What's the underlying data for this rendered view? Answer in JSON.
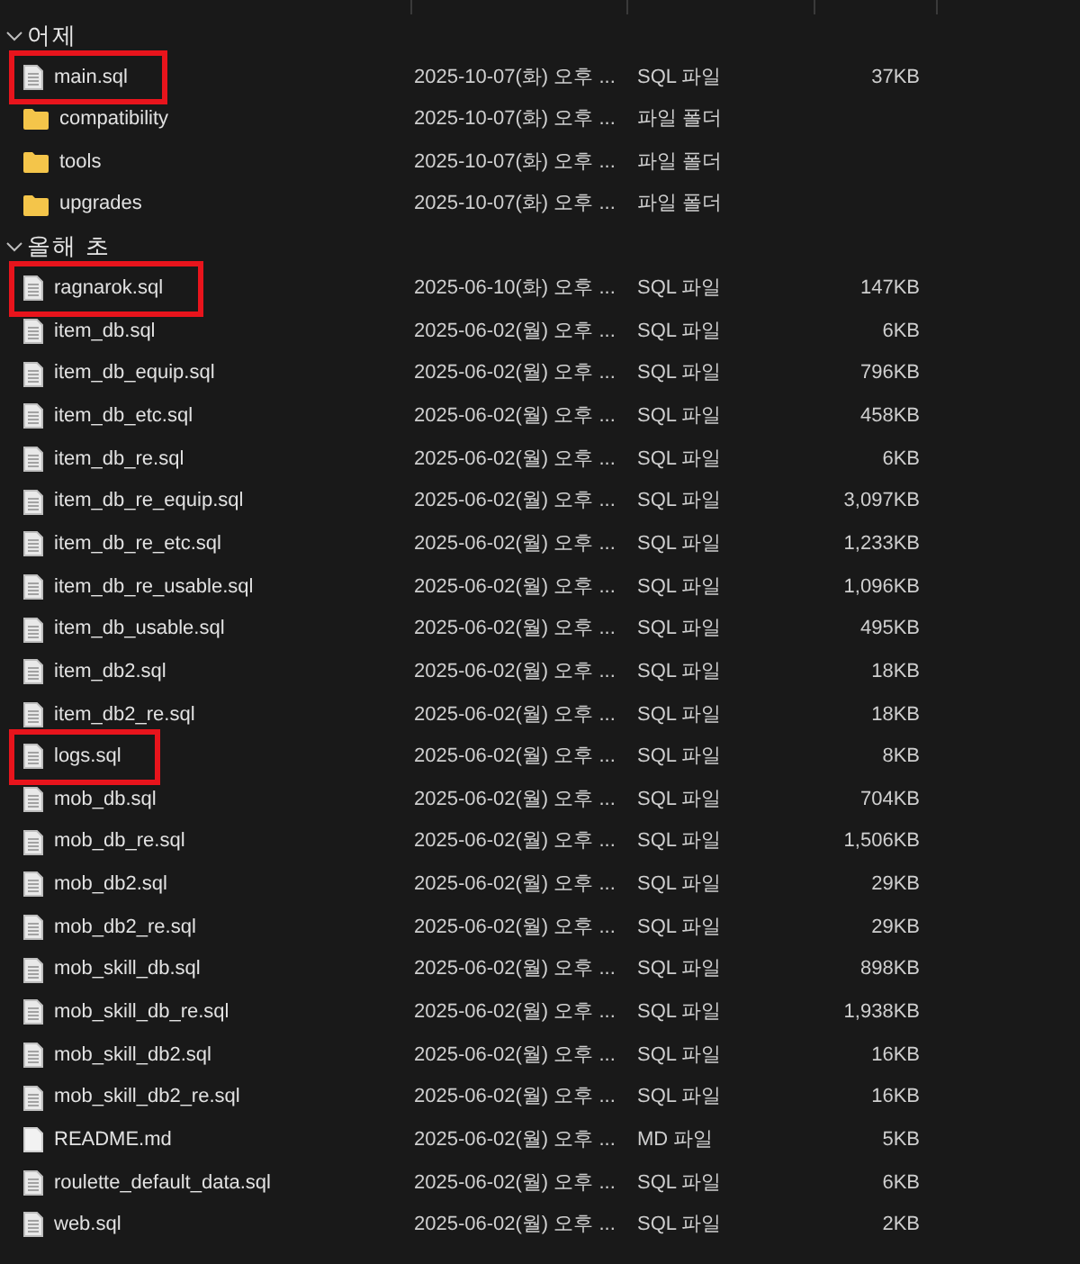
{
  "groups": [
    {
      "label": "어제",
      "expanded": true,
      "rows": [
        {
          "kind": "file",
          "name": "main.sql",
          "date": "2025-10-07(화) 오후 ...",
          "type": "SQL 파일",
          "size": "37KB",
          "highlighted": true
        },
        {
          "kind": "folder",
          "name": "compatibility",
          "date": "2025-10-07(화) 오후 ...",
          "type": "파일 폴더",
          "highlighted": false
        },
        {
          "kind": "folder",
          "name": "tools",
          "date": "2025-10-07(화) 오후 ...",
          "type": "파일 폴더",
          "highlighted": false
        },
        {
          "kind": "folder",
          "name": "upgrades",
          "date": "2025-10-07(화) 오후 ...",
          "type": "파일 폴더",
          "highlighted": false
        }
      ]
    },
    {
      "label": "올해 초",
      "expanded": true,
      "rows": [
        {
          "kind": "file",
          "name": "ragnarok.sql",
          "date": "2025-06-10(화) 오후 ...",
          "type": "SQL 파일",
          "size": "147KB",
          "highlighted": true
        },
        {
          "kind": "file",
          "name": "item_db.sql",
          "date": "2025-06-02(월) 오후 ...",
          "type": "SQL 파일",
          "size": "6KB",
          "highlighted": false
        },
        {
          "kind": "file",
          "name": "item_db_equip.sql",
          "date": "2025-06-02(월) 오후 ...",
          "type": "SQL 파일",
          "size": "796KB",
          "highlighted": false
        },
        {
          "kind": "file",
          "name": "item_db_etc.sql",
          "date": "2025-06-02(월) 오후 ...",
          "type": "SQL 파일",
          "size": "458KB",
          "highlighted": false
        },
        {
          "kind": "file",
          "name": "item_db_re.sql",
          "date": "2025-06-02(월) 오후 ...",
          "type": "SQL 파일",
          "size": "6KB",
          "highlighted": false
        },
        {
          "kind": "file",
          "name": "item_db_re_equip.sql",
          "date": "2025-06-02(월) 오후 ...",
          "type": "SQL 파일",
          "size": "3,097KB",
          "highlighted": false
        },
        {
          "kind": "file",
          "name": "item_db_re_etc.sql",
          "date": "2025-06-02(월) 오후 ...",
          "type": "SQL 파일",
          "size": "1,233KB",
          "highlighted": false
        },
        {
          "kind": "file",
          "name": "item_db_re_usable.sql",
          "date": "2025-06-02(월) 오후 ...",
          "type": "SQL 파일",
          "size": "1,096KB",
          "highlighted": false
        },
        {
          "kind": "file",
          "name": "item_db_usable.sql",
          "date": "2025-06-02(월) 오후 ...",
          "type": "SQL 파일",
          "size": "495KB",
          "highlighted": false
        },
        {
          "kind": "file",
          "name": "item_db2.sql",
          "date": "2025-06-02(월) 오후 ...",
          "type": "SQL 파일",
          "size": "18KB",
          "highlighted": false
        },
        {
          "kind": "file",
          "name": "item_db2_re.sql",
          "date": "2025-06-02(월) 오후 ...",
          "type": "SQL 파일",
          "size": "18KB",
          "highlighted": false
        },
        {
          "kind": "file",
          "name": "logs.sql",
          "date": "2025-06-02(월) 오후 ...",
          "type": "SQL 파일",
          "size": "8KB",
          "highlighted": true
        },
        {
          "kind": "file",
          "name": "mob_db.sql",
          "date": "2025-06-02(월) 오후 ...",
          "type": "SQL 파일",
          "size": "704KB",
          "highlighted": false
        },
        {
          "kind": "file",
          "name": "mob_db_re.sql",
          "date": "2025-06-02(월) 오후 ...",
          "type": "SQL 파일",
          "size": "1,506KB",
          "highlighted": false
        },
        {
          "kind": "file",
          "name": "mob_db2.sql",
          "date": "2025-06-02(월) 오후 ...",
          "type": "SQL 파일",
          "size": "29KB",
          "highlighted": false
        },
        {
          "kind": "file",
          "name": "mob_db2_re.sql",
          "date": "2025-06-02(월) 오후 ...",
          "type": "SQL 파일",
          "size": "29KB",
          "highlighted": false
        },
        {
          "kind": "file",
          "name": "mob_skill_db.sql",
          "date": "2025-06-02(월) 오후 ...",
          "type": "SQL 파일",
          "size": "898KB",
          "highlighted": false
        },
        {
          "kind": "file",
          "name": "mob_skill_db_re.sql",
          "date": "2025-06-02(월) 오후 ...",
          "type": "SQL 파일",
          "size": "1,938KB",
          "highlighted": false
        },
        {
          "kind": "file",
          "name": "mob_skill_db2.sql",
          "date": "2025-06-02(월) 오후 ...",
          "type": "SQL 파일",
          "size": "16KB",
          "highlighted": false
        },
        {
          "kind": "file",
          "name": "mob_skill_db2_re.sql",
          "date": "2025-06-02(월) 오후 ...",
          "type": "SQL 파일",
          "size": "16KB",
          "highlighted": false
        },
        {
          "kind": "doc",
          "name": "README.md",
          "date": "2025-06-02(월) 오후 ...",
          "type": "MD 파일",
          "size": "5KB",
          "highlighted": false
        },
        {
          "kind": "file",
          "name": "roulette_default_data.sql",
          "date": "2025-06-02(월) 오후 ...",
          "type": "SQL 파일",
          "size": "6KB",
          "highlighted": false
        },
        {
          "kind": "file",
          "name": "web.sql",
          "date": "2025-06-02(월) 오후 ...",
          "type": "SQL 파일",
          "size": "2KB",
          "highlighted": false
        }
      ]
    }
  ]
}
